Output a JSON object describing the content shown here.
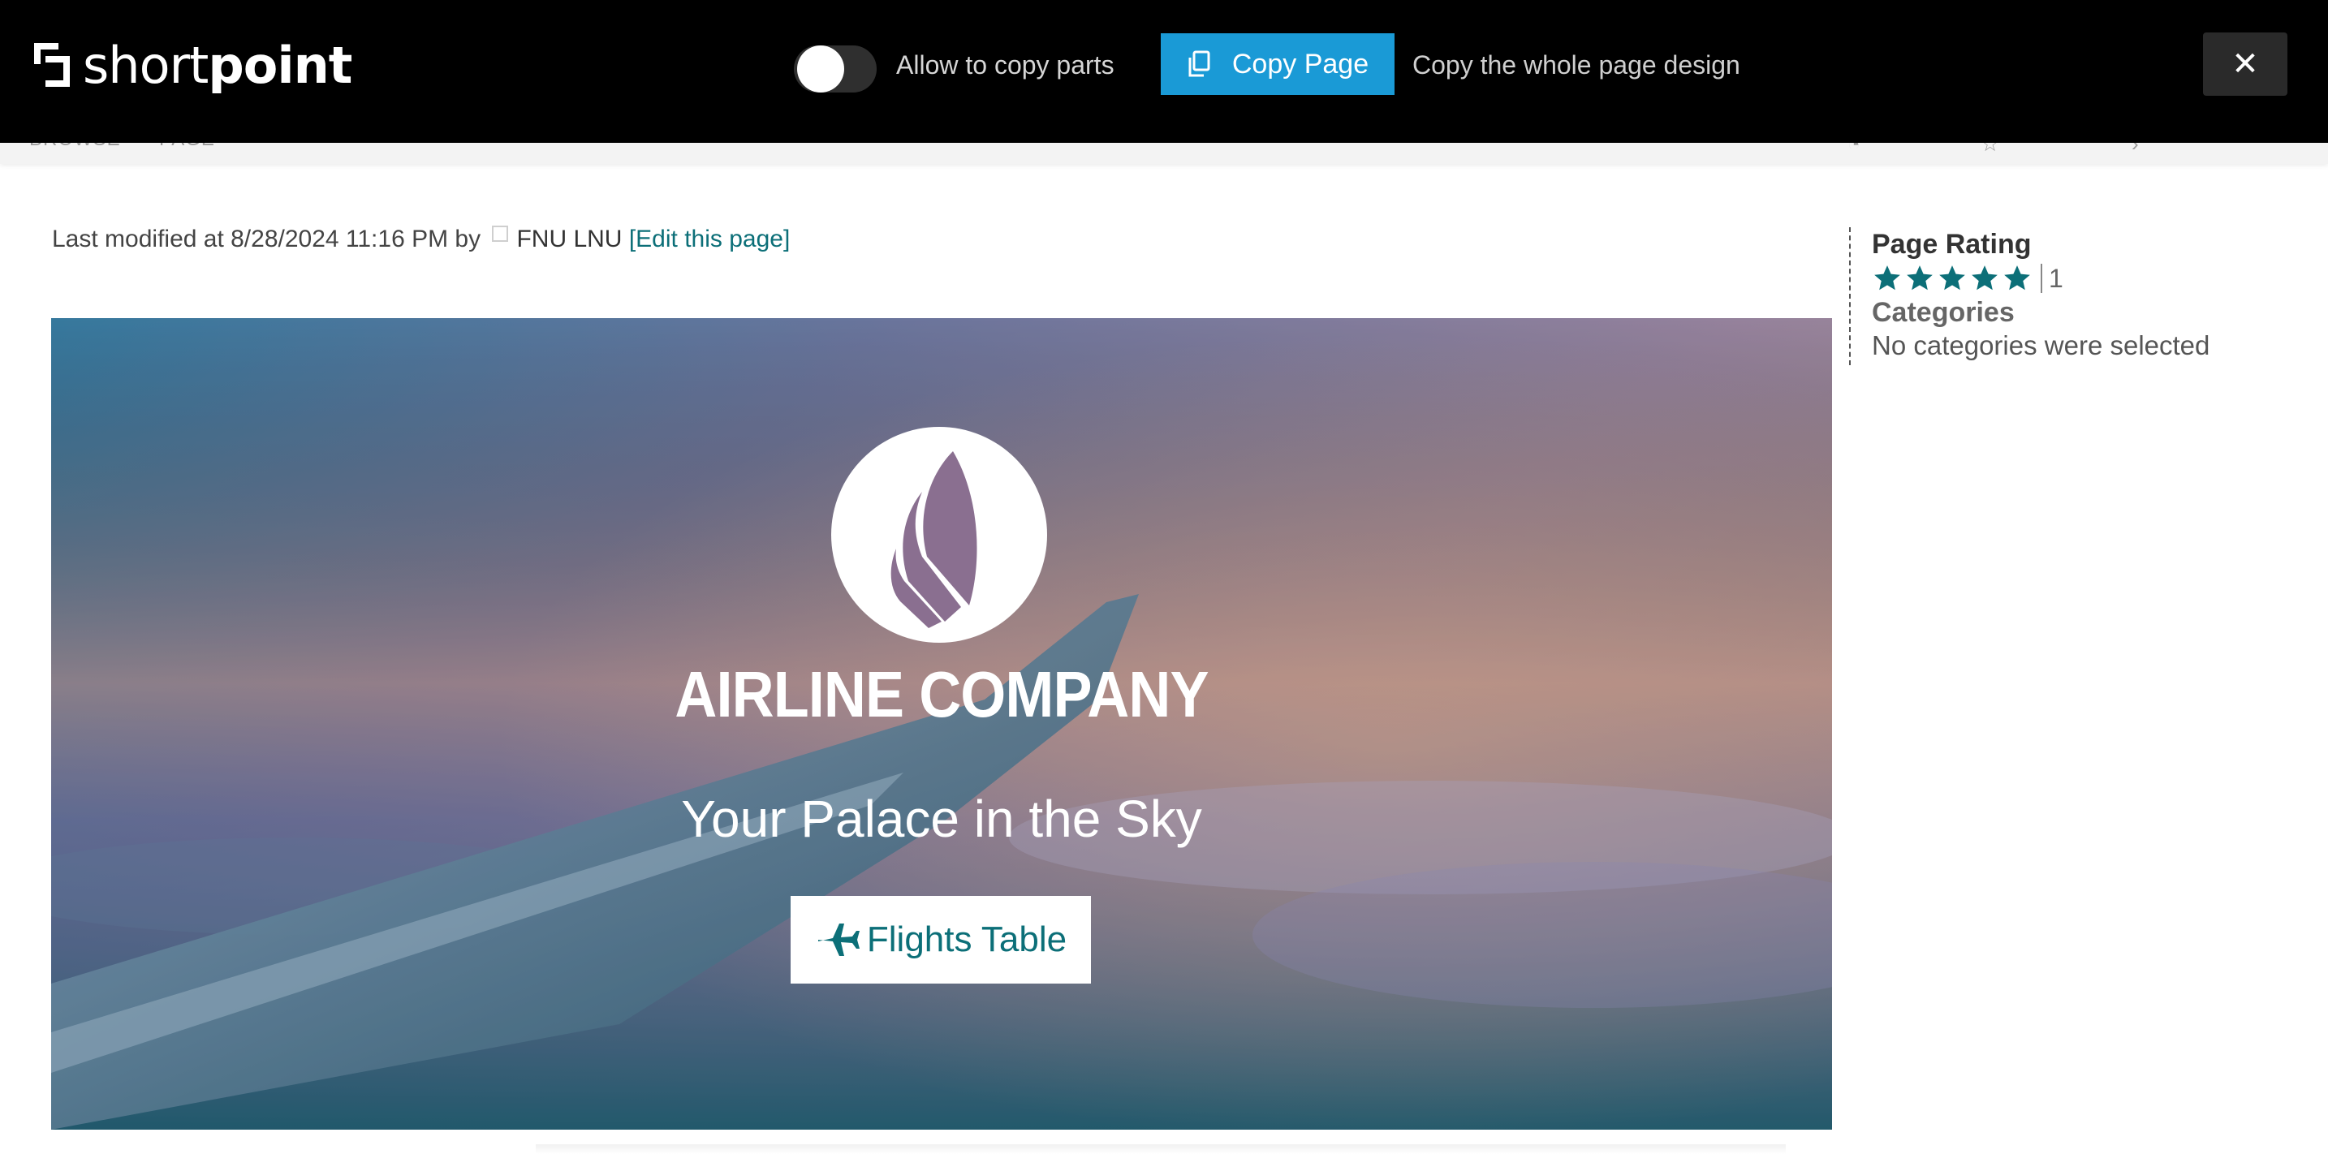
{
  "topbar": {
    "logo_light": "short",
    "logo_bold": "point",
    "toggle_label": "Allow to copy parts",
    "toggle_on": false,
    "copy_button_label": "Copy Page",
    "copy_description": "Copy the whole page design",
    "close_label": "✕"
  },
  "ribbon": {
    "tabs": [
      "BROWSE",
      "PAGE"
    ]
  },
  "page": {
    "modified_prefix": "Last modified at 8/28/2024 11:16 PM by",
    "author": "FNU LNU",
    "edit_link": "[Edit this page]"
  },
  "hero": {
    "title": "AIRLINE COMPANY",
    "tagline": "Your Palace in the Sky",
    "button_label": "Flights Table"
  },
  "sidebar": {
    "rating_heading": "Page Rating",
    "rating_stars": 5,
    "rating_count": "1",
    "categories_heading": "Categories",
    "categories_text": "No categories were selected"
  },
  "colors": {
    "accent_blue": "#1a9ad6",
    "teal": "#0c6f78",
    "topbar": "#000000"
  }
}
